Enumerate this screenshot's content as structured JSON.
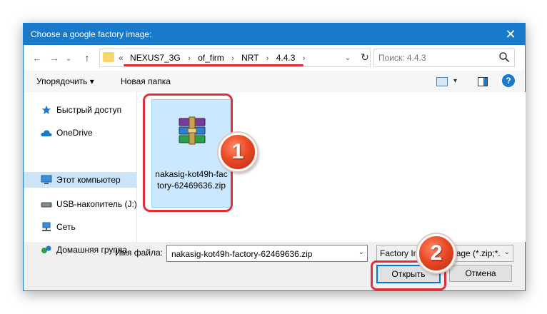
{
  "dialog": {
    "title": "Choose a google factory image:",
    "close_glyph": "✕"
  },
  "nav": {
    "back_glyph": "←",
    "forward_glyph": "→",
    "recent_glyph": "⌄",
    "up_glyph": "↑",
    "overflow": "«",
    "breadcrumbs": [
      "NEXUS7_3G",
      "of_firm",
      "NRT",
      "4.4.3"
    ],
    "sep_glyph": "›",
    "address_chevron": "⌄",
    "refresh_glyph": "↻",
    "search_placeholder": "Поиск: 4.4.3"
  },
  "toolbar": {
    "organize_label": "Упорядочить ▾",
    "new_folder_label": "Новая папка",
    "view_chevron": "▾",
    "help_glyph": "?"
  },
  "sidebar": {
    "items": [
      {
        "label": "Быстрый доступ",
        "icon": "star-icon",
        "color": "#1979ca"
      },
      {
        "label": "OneDrive",
        "icon": "cloud-icon",
        "color": "#1979ca"
      },
      {
        "label": "Этот компьютер",
        "icon": "computer-icon",
        "color": "#3a8fd8"
      },
      {
        "label": "USB-накопитель (J:)",
        "icon": "usb-drive-icon",
        "color": "#555555"
      },
      {
        "label": "Сеть",
        "icon": "network-icon",
        "color": "#3a8fd8"
      },
      {
        "label": "Домашняя группа",
        "icon": "homegroup-icon",
        "color": "#2aa04a"
      }
    ],
    "selected_index": 2
  },
  "content": {
    "file": {
      "name": "nakasig-kot49h-factory-62469636.zip",
      "icon": "winrar-archive-icon"
    }
  },
  "footer": {
    "filename_label": "Имя файла:",
    "filename_value": "nakasig-kot49h-factory-62469636.zip",
    "filter_text": "Factory Image Package (*.zip;*.",
    "combo_chevron": "⌄",
    "open_label": "Открыть",
    "cancel_label": "Отмена"
  },
  "annotations": {
    "badge_1": "1",
    "badge_2": "2"
  },
  "colors": {
    "accent": "#1979ca",
    "highlight": "#e0313a",
    "selection": "#cce8ff"
  }
}
